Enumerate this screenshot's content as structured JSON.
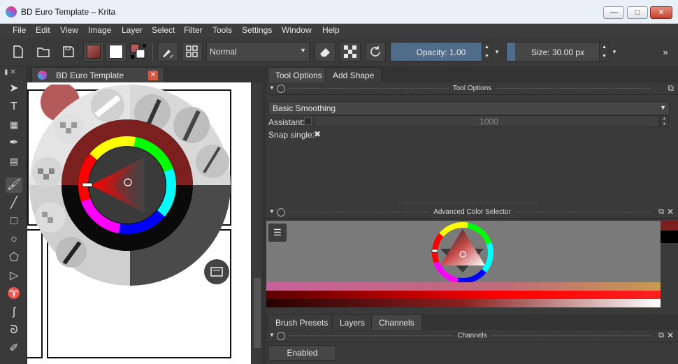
{
  "window": {
    "title": "BD Euro Template – Krita",
    "min": "—",
    "max": "□",
    "close": "✕"
  },
  "menu": [
    "File",
    "Edit",
    "View",
    "Image",
    "Layer",
    "Select",
    "Filter",
    "Tools",
    "Settings",
    "Window",
    "Help"
  ],
  "toolbar": {
    "blend_mode": "Normal",
    "opacity_label": "Opacity:",
    "opacity_value": "1.00",
    "opacity_fraction": 1.0,
    "size_label": "Size:",
    "size_value": "30.00 px",
    "size_fraction": 0.08,
    "more": "»"
  },
  "document_tab": {
    "label": "BD Euro Template",
    "close": "✕"
  },
  "tool_options": {
    "tabs": [
      "Tool Options",
      "Add Shape"
    ],
    "title": "Tool Options",
    "smoothing": "Basic Smoothing",
    "assistant_label": "Assistant:",
    "assistant_value": "1000",
    "snap_label": "Snap single:"
  },
  "advanced_color_selector": {
    "title": "Advanced Color Selector"
  },
  "bottom_tabs": [
    "Brush Presets",
    "Layers",
    "Channels"
  ],
  "channels": {
    "title": "Channels",
    "enabled_label": "Enabled"
  },
  "colors": {
    "foreground": "#b45a5a",
    "background": "#ffffff",
    "accent": "#4f6c8a",
    "current_color": "#7b1f1f"
  }
}
